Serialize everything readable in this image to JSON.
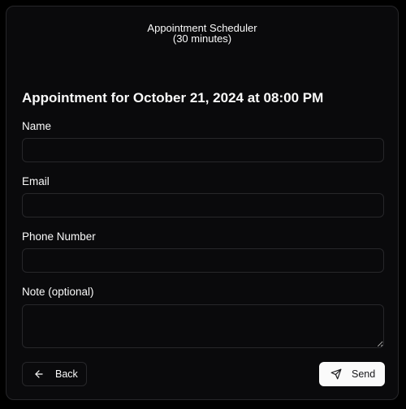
{
  "header": {
    "title_line1": "Appointment Scheduler",
    "title_line2": "(30 minutes)"
  },
  "form": {
    "title": "Appointment for October 21, 2024 at 08:00 PM",
    "fields": {
      "name": {
        "label": "Name",
        "value": "",
        "placeholder": ""
      },
      "email": {
        "label": "Email",
        "value": "",
        "placeholder": ""
      },
      "phone": {
        "label": "Phone Number",
        "value": "",
        "placeholder": ""
      },
      "note": {
        "label": "Note (optional)",
        "value": "",
        "placeholder": ""
      }
    }
  },
  "actions": {
    "back_label": "Back",
    "back_icon": "arrow-left-icon",
    "send_label": "Send",
    "send_icon": "send-icon"
  },
  "colors": {
    "background": "#000000",
    "card": "#0a0a0c",
    "border": "#27272a",
    "text": "#fafafa",
    "primary_button": "#fafafa",
    "primary_button_text": "#18181b"
  }
}
